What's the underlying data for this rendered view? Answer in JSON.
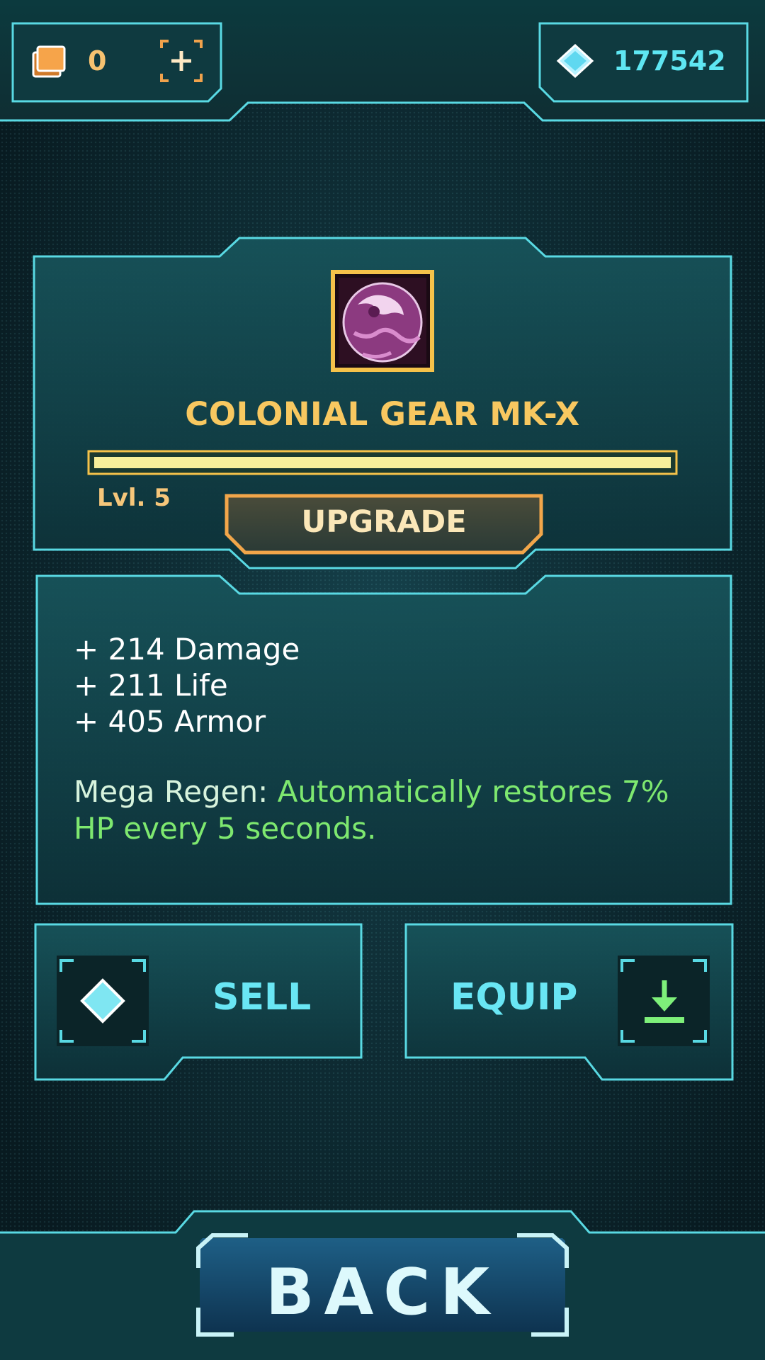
{
  "topbar": {
    "cards_count": "0",
    "gems_count": "177542"
  },
  "item": {
    "name": "COLONIAL GEAR MK-X",
    "level_label": "Lvl. 5",
    "level_progress": 1.0,
    "upgrade_label": "UPGRADE"
  },
  "stats": {
    "lines": [
      "+ 214 Damage",
      "+ 211 Life",
      "+ 405 Armor"
    ],
    "ability_name": "Mega Regen: ",
    "ability_desc": "Automatically restores 7% HP every 5 seconds."
  },
  "actions": {
    "sell_label": "SELL",
    "equip_label": "EQUIP",
    "back_label": "BACK"
  },
  "colors": {
    "frame": "#59d9e3",
    "gold": "#f8c860",
    "green": "#7ee86f",
    "cyan": "#69e6f4"
  },
  "icons": {
    "cards": "stacked-cards-icon",
    "add": "add-frame-icon",
    "gem": "diamond-gem-icon",
    "item": "gear-orb-icon",
    "sell": "diamond-gem-icon",
    "equip": "download-arrow-icon"
  }
}
